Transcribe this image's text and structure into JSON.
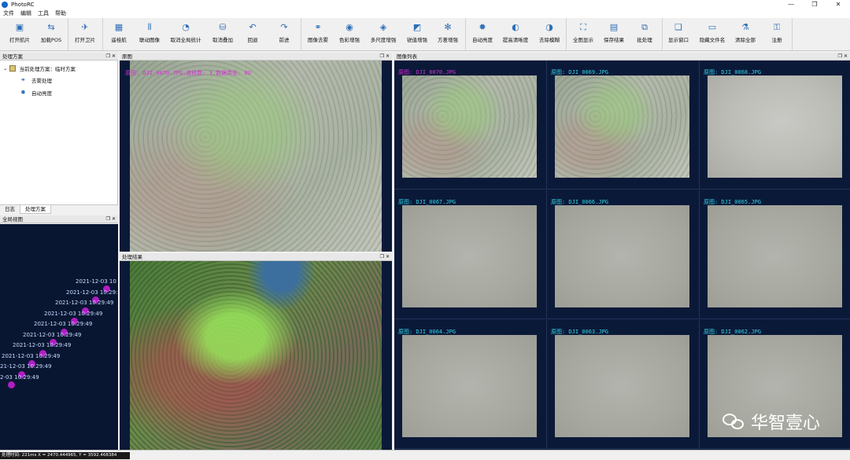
{
  "window": {
    "title": "PhotoRC",
    "controls": [
      "—",
      "❐",
      "✕"
    ]
  },
  "menu": [
    "文件",
    "编辑",
    "工具",
    "帮助"
  ],
  "toolbar": [
    {
      "label": "打开航片",
      "icon": "open-photo-icon",
      "glyph": "▣"
    },
    {
      "label": "加载POS",
      "icon": "load-pos-icon",
      "glyph": "⇆"
    },
    {
      "label": "打开卫片",
      "icon": "satellite-icon",
      "glyph": "✈"
    },
    {
      "label": "遥桂航",
      "icon": "map-icon",
      "glyph": "▦"
    },
    {
      "label": "联动图像",
      "icon": "link-images-icon",
      "glyph": "⫴"
    },
    {
      "label": "取消全局统计",
      "icon": "cancel-stats-icon",
      "glyph": "◔"
    },
    {
      "label": "取消叠加",
      "icon": "cancel-overlay-icon",
      "glyph": "⛁"
    },
    {
      "label": "回退",
      "icon": "undo-icon",
      "glyph": "↶"
    },
    {
      "label": "前进",
      "icon": "redo-icon",
      "glyph": "↷"
    },
    {
      "label": "图像去雾",
      "icon": "dehaze-icon",
      "glyph": "⚭"
    },
    {
      "label": "色彩增强",
      "icon": "color-enhance-icon",
      "glyph": "◉"
    },
    {
      "label": "多尺度增强",
      "icon": "multiscale-icon",
      "glyph": "◈"
    },
    {
      "label": "锐值增强",
      "icon": "sharpen-icon",
      "glyph": "◩"
    },
    {
      "label": "方差增强",
      "icon": "variance-icon",
      "glyph": "✻"
    },
    {
      "label": "自动亮度",
      "icon": "auto-brightness-icon",
      "glyph": "✹"
    },
    {
      "label": "提高清晰度",
      "icon": "clarity-icon",
      "glyph": "◐"
    },
    {
      "label": "去除模糊",
      "icon": "deblur-icon",
      "glyph": "◑"
    },
    {
      "label": "全图显示",
      "icon": "fit-view-icon",
      "glyph": "⛶"
    },
    {
      "label": "保存结果",
      "icon": "save-icon",
      "glyph": "▤"
    },
    {
      "label": "批处理",
      "icon": "batch-icon",
      "glyph": "⧉"
    },
    {
      "label": "显示窗口",
      "icon": "window-icon",
      "glyph": "❏"
    },
    {
      "label": "隐藏文件名",
      "icon": "hide-name-icon",
      "glyph": "▭"
    },
    {
      "label": "清除全部",
      "icon": "clear-icon",
      "glyph": "⚗"
    },
    {
      "label": "注册",
      "icon": "register-icon",
      "glyph": "⚿"
    }
  ],
  "panels": {
    "scheme": "处理方案",
    "overview": "全局视图",
    "original": "原图",
    "result": "处理结果",
    "list": "图像列表"
  },
  "tree": {
    "root": "当前处理方案：临时方案",
    "items": [
      "去雾处理",
      "自动亮度"
    ]
  },
  "tabs": [
    "日志",
    "处理方案"
  ],
  "overview_labels": [
    "2021-12-03 10",
    "2021-12-03 10:29:",
    "2021-12-03 10:29:49",
    "2021-12-03 10:29:49",
    "2021-12-03 10:29:49",
    "2021-12-03 10:29:49",
    "2021-12-03 10:29:49",
    "2021-12-03 10:29:49",
    "21-12-03 10:29:49",
    "2-03 10:29:49"
  ],
  "original_overlay": "原图: DJI_0070.JPG,波段数: 3,数据类型: 8U",
  "image_list": [
    "原图: DJI_0070.JPG",
    "原图: DJI_0069.JPG",
    "原图: DJI_0068.JPG",
    "原图: DJI_0067.JPG",
    "原图: DJI_0066.JPG",
    "原图: DJI_0065.JPG",
    "原图: DJI_0064.JPG",
    "原图: DJI_0063.JPG",
    "原图: DJI_0062.JPG"
  ],
  "watermark": "华智壹心",
  "status": "处理时间: 221ms X = 2470.444965, Y = 3592.468384"
}
